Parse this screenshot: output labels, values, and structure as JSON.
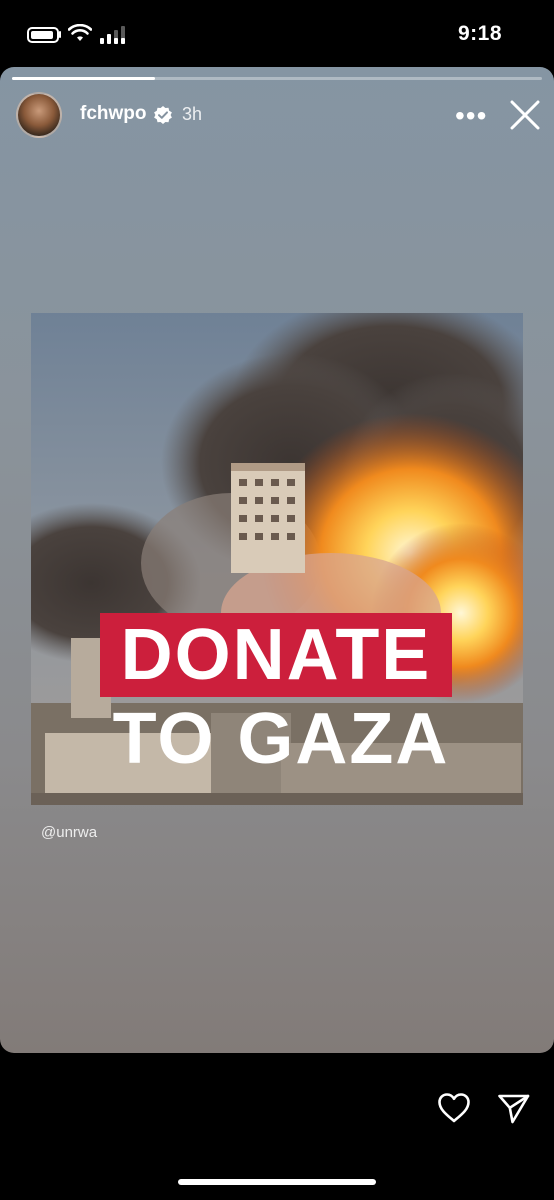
{
  "status_bar": {
    "time": "9:18"
  },
  "story": {
    "progress": 0.27,
    "username": "fchwpo",
    "verified": true,
    "time_ago": "3h",
    "more_label": "•••",
    "post": {
      "headline_1": "DONATE",
      "headline_2": "TO GAZA",
      "accent_color": "#cc1f3c"
    },
    "credit": "@unrwa"
  },
  "icons": [
    "battery-icon",
    "wifi-icon",
    "cellular-icon",
    "verified-icon",
    "more-icon",
    "close-icon",
    "heart-icon",
    "send-icon"
  ]
}
